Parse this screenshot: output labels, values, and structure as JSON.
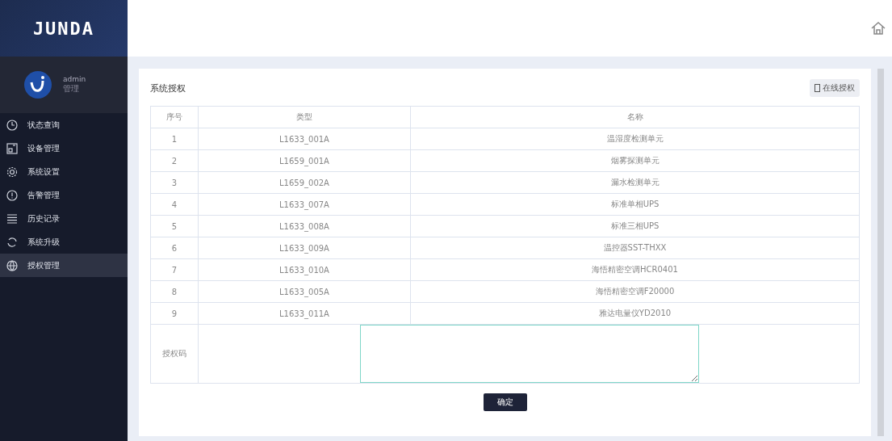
{
  "logo": "JUNDA",
  "user": {
    "name": "admin",
    "role": "管理"
  },
  "sidebar": {
    "items": [
      {
        "label": "状态查询",
        "selected": false
      },
      {
        "label": "设备管理",
        "selected": false
      },
      {
        "label": "系统设置",
        "selected": false
      },
      {
        "label": "告警管理",
        "selected": false
      },
      {
        "label": "历史记录",
        "selected": false
      },
      {
        "label": "系统升级",
        "selected": false
      },
      {
        "label": "授权管理",
        "selected": true
      }
    ]
  },
  "page": {
    "title": "系统授权",
    "online_button": "在线授权"
  },
  "table": {
    "columns": [
      "序号",
      "类型",
      "名称"
    ],
    "rows": [
      [
        "1",
        "L1633_001A",
        "温湿度检测单元"
      ],
      [
        "2",
        "L1659_001A",
        "烟雾探测单元"
      ],
      [
        "3",
        "L1659_002A",
        "漏水检测单元"
      ],
      [
        "4",
        "L1633_007A",
        "标准单相UPS"
      ],
      [
        "5",
        "L1633_008A",
        "标准三相UPS"
      ],
      [
        "6",
        "L1633_009A",
        "温控器SST-THXX"
      ],
      [
        "7",
        "L1633_010A",
        "海悟精密空调HCR0401"
      ],
      [
        "8",
        "L1633_005A",
        "海悟精密空调F20000"
      ],
      [
        "9",
        "L1633_011A",
        "雅达电量仪YD2010"
      ]
    ]
  },
  "auth_code": {
    "label": "授权码"
  },
  "confirm_button": "确定"
}
